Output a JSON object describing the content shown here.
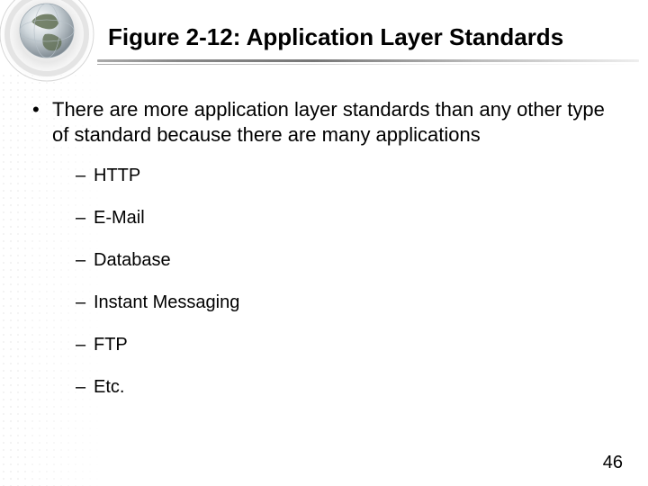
{
  "title": "Figure 2-12: Application Layer Standards",
  "bullets": {
    "main": "There are more application layer standards than any other type of standard because there are many applications",
    "sub": [
      "HTTP",
      "E-Mail",
      "Database",
      "Instant Messaging",
      "FTP",
      "Etc."
    ]
  },
  "page_number": "46"
}
